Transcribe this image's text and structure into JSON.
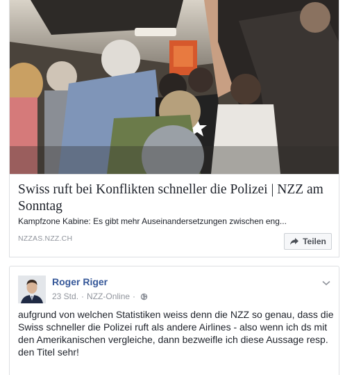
{
  "link_preview": {
    "title": "Swiss ruft bei Konflikten schneller die Polizei | NZZ am Sonntag",
    "description": "Kampfzone Kabine: Es gibt mehr Auseinandersetzungen zwischen eng...",
    "domain": "NZZAS.NZZ.CH",
    "share_label": "Teilen",
    "share_icon": "share-arrow-icon",
    "image_icon": "airplane-cabin-photo"
  },
  "comment": {
    "author": "Roger Riger",
    "time": "23 Std.",
    "separator": "·",
    "source": "NZZ-Online",
    "privacy_icon": "globe-icon",
    "menu_icon": "chevron-down-icon",
    "text": "aufgrund von welchen Statistiken weiss denn die NZZ so genau, dass die Swiss schneller die Polizei ruft als andere Airlines - also wenn ich ds mit den Amerikanischen vergleiche, dann bezweifle ich diese Aussage resp. den Titel sehr!"
  },
  "colors": {
    "link_blue": "#365899",
    "meta_gray": "#90949c",
    "border": "#dddfe2"
  }
}
